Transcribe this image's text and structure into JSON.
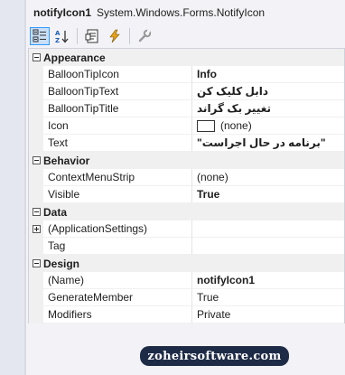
{
  "header": {
    "object_name": "notifyIcon1",
    "object_type": "System.Windows.Forms.NotifyIcon"
  },
  "toolbar": {
    "buttons": [
      {
        "icon": "categorized-icon",
        "active": true
      },
      {
        "icon": "alphabetical-icon",
        "active": false
      },
      {
        "icon": "properties-icon",
        "active": false
      },
      {
        "icon": "events-lightning-icon",
        "active": false
      },
      {
        "icon": "property-pages-wrench-icon",
        "active": false
      }
    ]
  },
  "categories": {
    "appearance": {
      "label": "Appearance",
      "rows": [
        {
          "name": "BalloonTipIcon",
          "value": "Info"
        },
        {
          "name": "BalloonTipText",
          "value": "دابل کلیک کن"
        },
        {
          "name": "BalloonTipTitle",
          "value": "تغییر بک گراند"
        },
        {
          "name": "Icon",
          "value": "(none)"
        },
        {
          "name": "Text",
          "value": "\"برنامه در حال اجراست\""
        }
      ]
    },
    "behavior": {
      "label": "Behavior",
      "rows": [
        {
          "name": "ContextMenuStrip",
          "value": "(none)"
        },
        {
          "name": "Visible",
          "value": "True"
        }
      ]
    },
    "data": {
      "label": "Data",
      "rows": [
        {
          "name": "(ApplicationSettings)",
          "value": ""
        },
        {
          "name": "Tag",
          "value": ""
        }
      ]
    },
    "design": {
      "label": "Design",
      "rows": [
        {
          "name": "(Name)",
          "value": "notifyIcon1"
        },
        {
          "name": "GenerateMember",
          "value": "True"
        },
        {
          "name": "Modifiers",
          "value": "Private"
        }
      ]
    }
  },
  "watermark": "zoheirsoftware.com",
  "colors": {
    "selected_tool": "#c9def5",
    "selected_tool_border": "#3399ff",
    "watermark_bg": "#1e2b47"
  }
}
